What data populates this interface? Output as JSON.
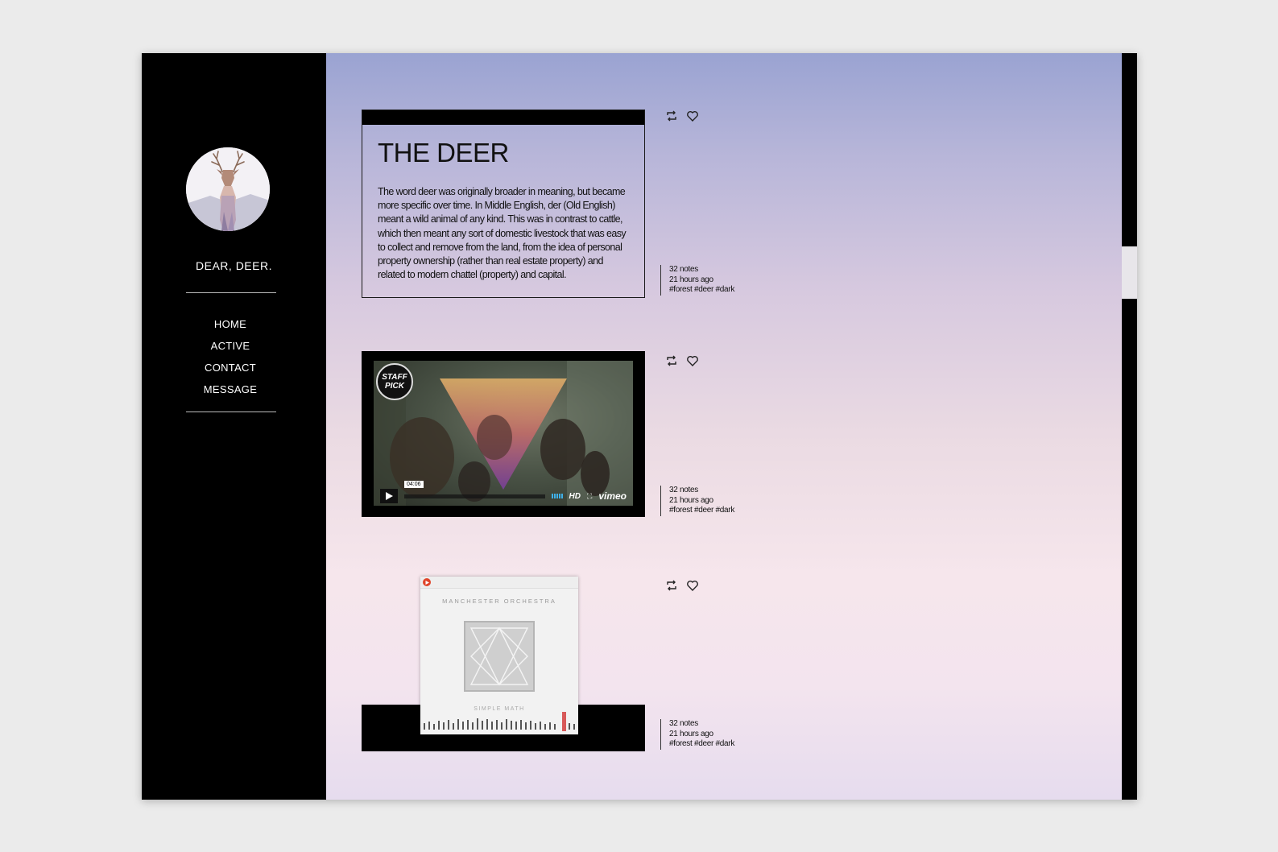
{
  "site": {
    "title": "DEAR, DEER.",
    "nav": [
      "HOME",
      "ACTIVE",
      "CONTACT",
      "MESSAGE"
    ]
  },
  "posts": [
    {
      "type": "text",
      "title": "THE DEER",
      "body": "The word deer was originally broader in meaning, but became more specific over time. In Middle English, der (Old English) meant a wild animal of any kind. This was in contrast to cattle, which then meant any sort of domestic livestock that was easy to collect and remove from the land, from the idea of personal property ownership (rather than real estate property) and related to modern chattel (property) and capital.",
      "notes": "32 notes",
      "time": "21 hours ago",
      "tags": "#forest #deer #dark"
    },
    {
      "type": "video",
      "badge": "STAFF PICK",
      "duration": "04:06",
      "hd_label": "HD",
      "provider": "vimeo",
      "notes": "32 notes",
      "time": "21 hours ago",
      "tags": "#forest #deer #dark"
    },
    {
      "type": "audio",
      "artist": "MANCHESTER ORCHESTRA",
      "album": "SIMPLE MATH",
      "notes": "32 notes",
      "time": "21 hours ago",
      "tags": "#forest #deer #dark"
    }
  ],
  "icons": {
    "reblog": "reblog-icon",
    "like": "heart-icon",
    "play": "play-icon"
  },
  "colors": {
    "sidebar": "#000000",
    "gradient_top": "#9aa3d2",
    "gradient_bottom": "#f3e4ee"
  }
}
